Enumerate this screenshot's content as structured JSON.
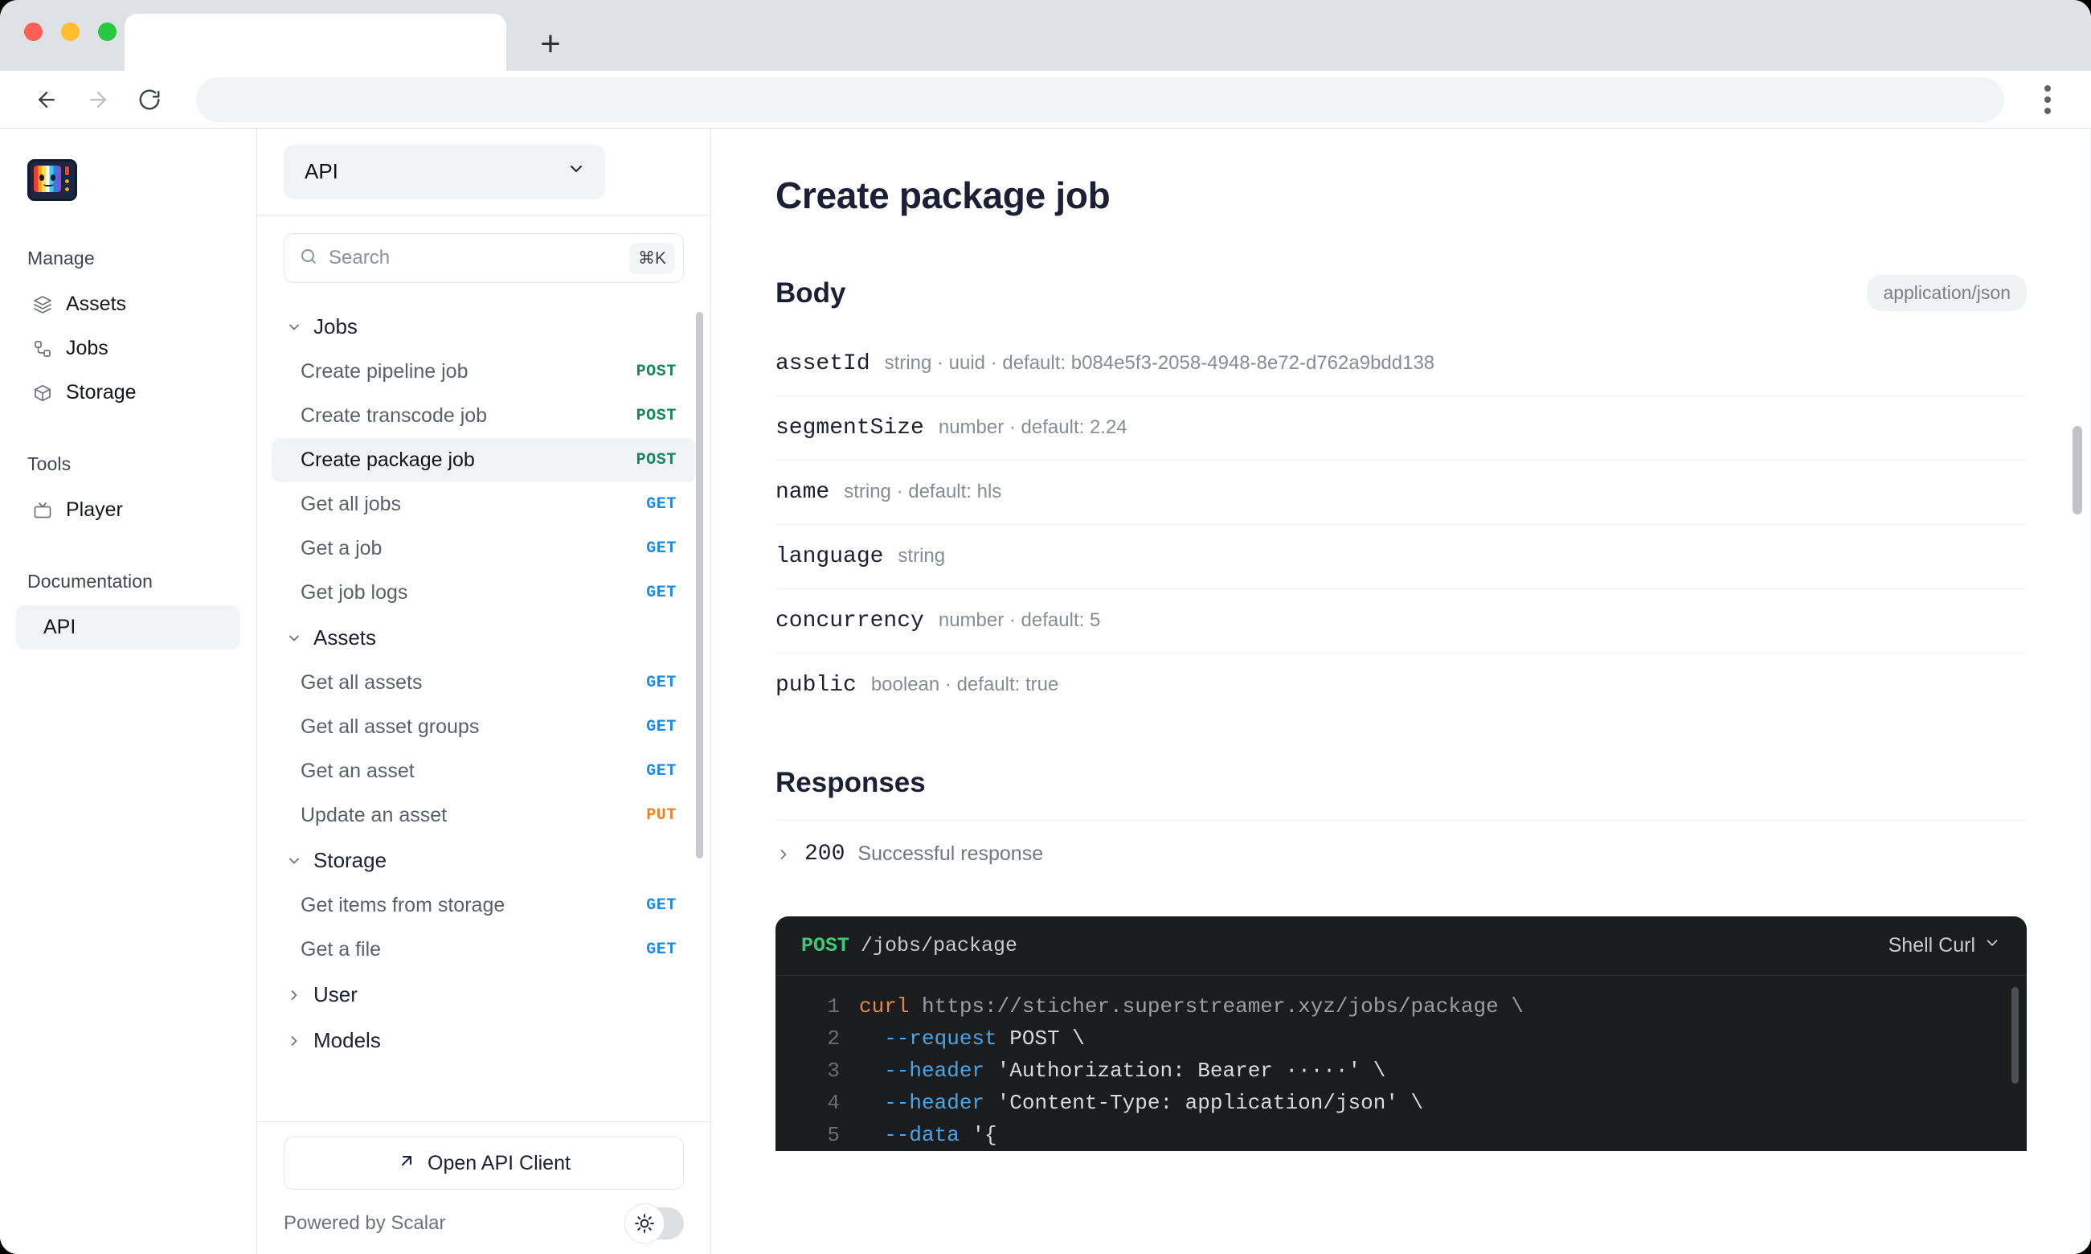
{
  "browser": {
    "tab_title": "",
    "url": "",
    "url_placeholder": "",
    "back_icon": "back-arrow-icon",
    "forward_icon": "forward-arrow-icon",
    "reload_icon": "reload-icon",
    "new_tab_label": "+",
    "menu_icon": "kebab-menu-icon"
  },
  "appbar": {
    "logo_alt": "superstreamer-logo",
    "sections": [
      {
        "title": "Manage",
        "items": [
          {
            "label": "Assets",
            "icon": "layers-icon",
            "active": false
          },
          {
            "label": "Jobs",
            "icon": "workflow-icon",
            "active": false
          },
          {
            "label": "Storage",
            "icon": "box-icon",
            "active": false
          }
        ]
      },
      {
        "title": "Tools",
        "items": [
          {
            "label": "Player",
            "icon": "tv-icon",
            "active": false
          }
        ]
      },
      {
        "title": "Documentation",
        "items": [
          {
            "label": "API",
            "icon": "",
            "active": true
          }
        ]
      }
    ]
  },
  "reference": {
    "api_select": {
      "value": "API",
      "chevron": "chevron-down-icon"
    },
    "search": {
      "placeholder": "Search",
      "shortcut": "⌘K",
      "icon": "search-icon"
    },
    "groups": [
      {
        "label": "Jobs",
        "expanded": true,
        "operations": [
          {
            "label": "Create pipeline job",
            "method": "POST",
            "active": false
          },
          {
            "label": "Create transcode job",
            "method": "POST",
            "active": false
          },
          {
            "label": "Create package job",
            "method": "POST",
            "active": true
          },
          {
            "label": "Get all jobs",
            "method": "GET",
            "active": false
          },
          {
            "label": "Get a job",
            "method": "GET",
            "active": false
          },
          {
            "label": "Get job logs",
            "method": "GET",
            "active": false
          }
        ]
      },
      {
        "label": "Assets",
        "expanded": true,
        "operations": [
          {
            "label": "Get all assets",
            "method": "GET",
            "active": false
          },
          {
            "label": "Get all asset groups",
            "method": "GET",
            "active": false
          },
          {
            "label": "Get an asset",
            "method": "GET",
            "active": false
          },
          {
            "label": "Update an asset",
            "method": "PUT",
            "active": false
          }
        ]
      },
      {
        "label": "Storage",
        "expanded": true,
        "operations": [
          {
            "label": "Get items from storage",
            "method": "GET",
            "active": false
          },
          {
            "label": "Get a file",
            "method": "GET",
            "active": false
          }
        ]
      },
      {
        "label": "User",
        "expanded": false,
        "operations": []
      },
      {
        "label": "Models",
        "expanded": false,
        "operations": []
      }
    ],
    "open_client_label": "Open API Client",
    "open_client_icon": "external-link-icon",
    "powered_by": "Powered by Scalar",
    "theme_toggle_icon": "sun-icon"
  },
  "content": {
    "title": "Create package job",
    "body_heading": "Body",
    "content_type": "application/json",
    "parameters": [
      {
        "name": "assetId",
        "meta": "string · uuid · default: b084e5f3-2058-4948-8e72-d762a9bdd138"
      },
      {
        "name": "segmentSize",
        "meta": "number · default: 2.24"
      },
      {
        "name": "name",
        "meta": "string · default: hls"
      },
      {
        "name": "language",
        "meta": "string"
      },
      {
        "name": "concurrency",
        "meta": "number · default: 5"
      },
      {
        "name": "public",
        "meta": "boolean · default: true"
      }
    ],
    "responses_heading": "Responses",
    "responses": [
      {
        "code": "200",
        "description": "Successful response",
        "expanded": false,
        "chevron": "chevron-right-icon"
      }
    ],
    "code_sample": {
      "method": "POST",
      "path": "/jobs/package",
      "language_label": "Shell Curl",
      "language_chevron": "chevron-down-icon",
      "lines": [
        {
          "n": "1",
          "command": "curl",
          "url": " https://sticher.superstreamer.xyz/jobs/package \\"
        },
        {
          "n": "2",
          "flag": "  --request ",
          "rest": "POST \\"
        },
        {
          "n": "3",
          "flag": "  --header ",
          "rest": "'Authorization: Bearer ·····' \\"
        },
        {
          "n": "4",
          "flag": "  --header ",
          "rest": "'Content-Type: application/json' \\"
        },
        {
          "n": "5",
          "flag": "  --data ",
          "rest": "'{"
        }
      ]
    }
  }
}
